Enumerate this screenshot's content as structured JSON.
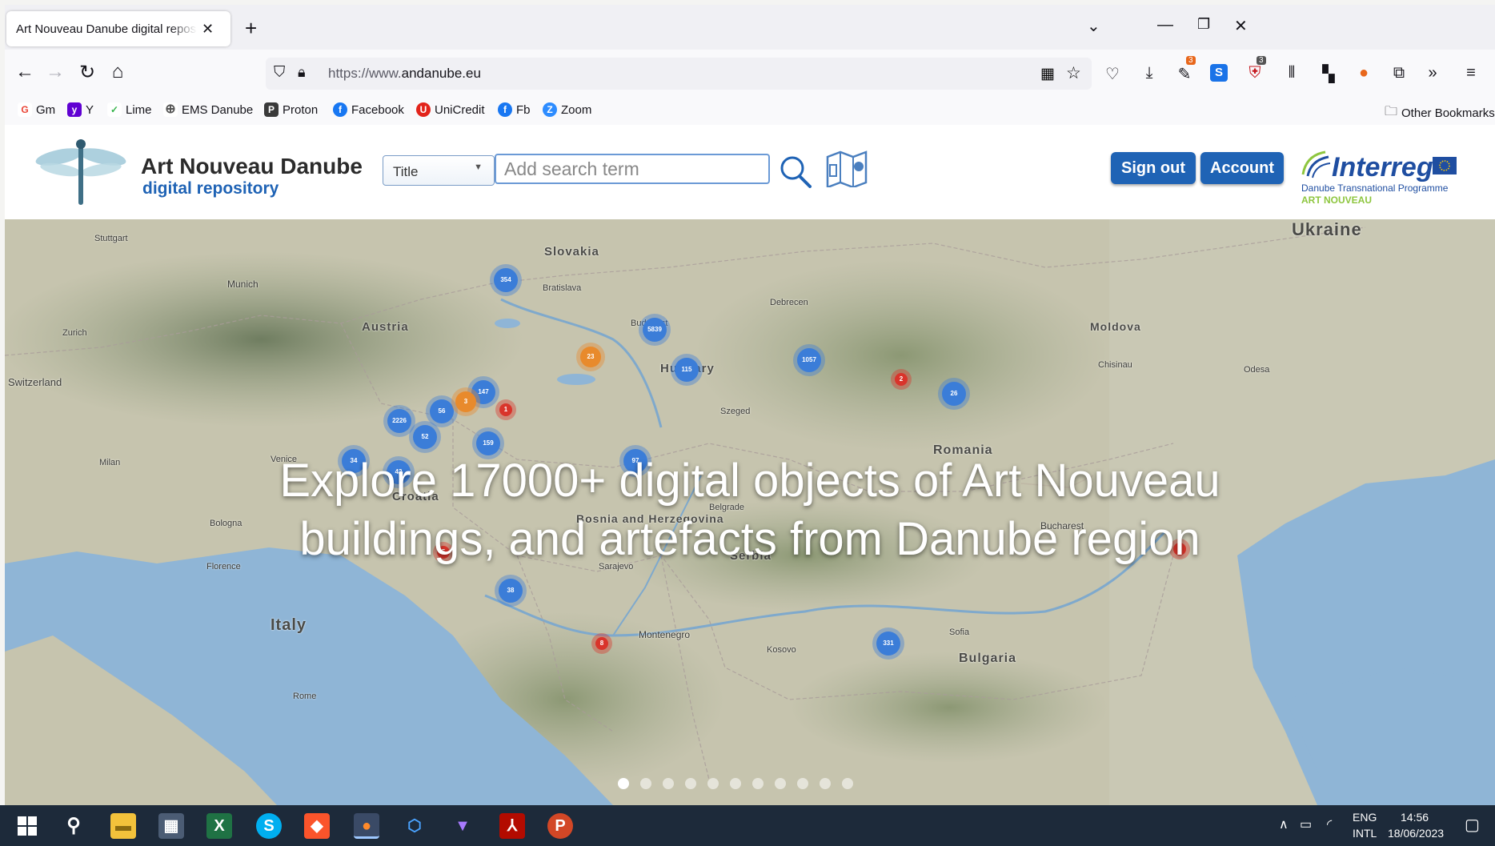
{
  "browser": {
    "tab_title": "Art Nouveau Danube digital reposito",
    "tab_close": "✕",
    "new_tab": "+",
    "url_prefix": "https://www.",
    "url_domain": "andanube.eu",
    "badges": {
      "ext1": "3",
      "ext2": "3"
    },
    "other_bookmarks": "Other Bookmarks"
  },
  "bookmarks": [
    {
      "label": "Gm",
      "icon": "G",
      "color": "#ea4335"
    },
    {
      "label": "Y",
      "icon": "y",
      "color": "#6001d2"
    },
    {
      "label": "Lime",
      "icon": "✓",
      "color": "#35b34a"
    },
    {
      "label": "EMS Danube",
      "icon": "⊕",
      "color": "#555555"
    },
    {
      "label": "Proton",
      "icon": "P",
      "color": "#3a3a3a"
    },
    {
      "label": "Facebook",
      "icon": "f",
      "color": "#1877f2"
    },
    {
      "label": "UniCredit",
      "icon": "U",
      "color": "#e2231a"
    },
    {
      "label": "Fb",
      "icon": "f",
      "color": "#1877f2"
    },
    {
      "label": "Zoom",
      "icon": "Z",
      "color": "#2d8cff"
    }
  ],
  "site": {
    "title": "Art Nouveau Danube",
    "subtitle": "digital repository",
    "search_select": "Title",
    "search_placeholder": "Add search term",
    "sign_out": "Sign out",
    "account": "Account",
    "interreg": "Interreg",
    "programme": "Danube Transnational Programme",
    "programme_project": "ART NOUVEAU",
    "hero_line1": "Explore 17000+ digital objects of Art Nouveau",
    "hero_line2": "buildings, and artefacts from Danube region"
  },
  "map": {
    "places": [
      {
        "name": "Ukraine"
      },
      {
        "name": "Slovakia"
      },
      {
        "name": "Austria"
      },
      {
        "name": "Hungary"
      },
      {
        "name": "Moldova"
      },
      {
        "name": "Switzerland"
      },
      {
        "name": "Romania"
      },
      {
        "name": "Croatia"
      },
      {
        "name": "Bosnia and Herzegovina"
      },
      {
        "name": "Serbia"
      },
      {
        "name": "Italy"
      },
      {
        "name": "Bulgaria"
      },
      {
        "name": "Montenegro"
      },
      {
        "name": "Kosovo"
      },
      {
        "name": "Munich"
      },
      {
        "name": "Stuttgart"
      },
      {
        "name": "Bratislava"
      },
      {
        "name": "Zurich"
      },
      {
        "name": "Milan"
      },
      {
        "name": "Venice"
      },
      {
        "name": "Bucharest"
      },
      {
        "name": "Sofia"
      },
      {
        "name": "Sarajevo"
      },
      {
        "name": "Belgrade"
      },
      {
        "name": "Chisinau"
      },
      {
        "name": "Odesa"
      },
      {
        "name": "Debrecen"
      },
      {
        "name": "Szeged"
      },
      {
        "name": "Bologna"
      },
      {
        "name": "Florence"
      },
      {
        "name": "Rome"
      },
      {
        "name": "Budapest"
      }
    ],
    "clusters": [
      {
        "n": "354",
        "type": "blue"
      },
      {
        "n": "5839",
        "type": "blue"
      },
      {
        "n": "115",
        "type": "blue"
      },
      {
        "n": "1057",
        "type": "blue"
      },
      {
        "n": "147",
        "type": "blue"
      },
      {
        "n": "56",
        "type": "blue"
      },
      {
        "n": "2226",
        "type": "blue"
      },
      {
        "n": "52",
        "type": "blue"
      },
      {
        "n": "34",
        "type": "blue"
      },
      {
        "n": "42",
        "type": "blue"
      },
      {
        "n": "97",
        "type": "blue"
      },
      {
        "n": "26",
        "type": "blue"
      },
      {
        "n": "38",
        "type": "blue"
      },
      {
        "n": "331",
        "type": "blue"
      },
      {
        "n": "159",
        "type": "blue"
      },
      {
        "n": "23",
        "type": "orange"
      },
      {
        "n": "3",
        "type": "orange"
      },
      {
        "n": "1",
        "type": "red"
      },
      {
        "n": "2",
        "type": "red"
      },
      {
        "n": "3",
        "type": "red"
      },
      {
        "n": "8",
        "type": "red"
      },
      {
        "n": "5",
        "type": "red"
      }
    ],
    "slides": 11,
    "active_slide": 1
  },
  "taskbar": {
    "lang": "ENG",
    "layout": "INTL",
    "time": "14:56",
    "date": "18/06/2023"
  },
  "colors": {
    "brand_blue": "#1f63b5",
    "cluster_blue": "#3b7dd8",
    "cluster_orange": "#e88a2c",
    "cluster_red": "#d9342b"
  }
}
